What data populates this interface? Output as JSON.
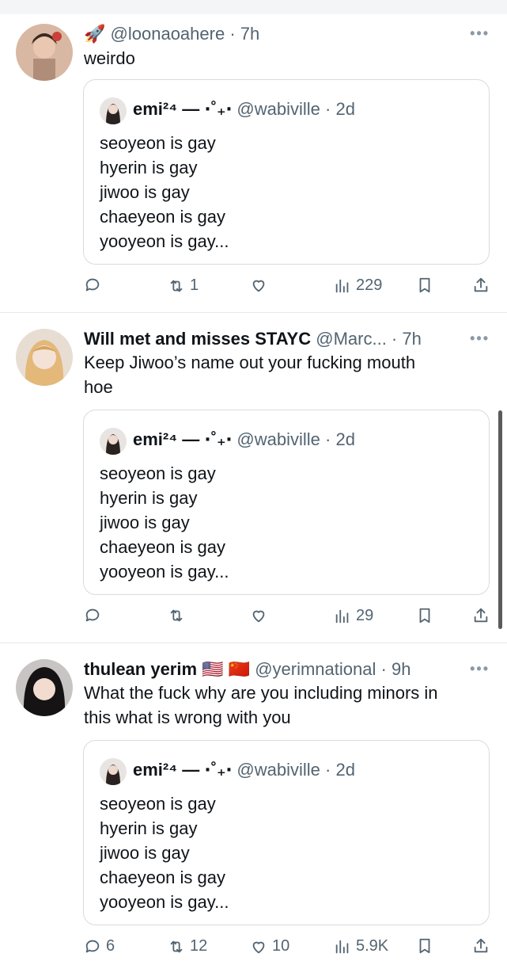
{
  "tweets": [
    {
      "display_name": "",
      "badge_emoji": "🚀",
      "handle": "@loonaoahere",
      "time": "7h",
      "text": [
        "weirdo"
      ],
      "quote": {
        "name": "emi²⁴ — ⋅˚₊‧",
        "handle": "@wabiville",
        "time": "2d",
        "lines": [
          "seoyeon is gay",
          "hyerin is gay",
          "jiwoo is gay",
          "chaeyeon is gay",
          "yooyeon is gay..."
        ]
      },
      "stats": {
        "replies": "",
        "retweets": "1",
        "likes": "",
        "views": "229"
      }
    },
    {
      "display_name": "Will met and misses STAYC",
      "badge_emoji": "",
      "handle": "@Marc...",
      "time": "7h",
      "text": [
        "Keep Jiwoo’s name out your fucking mouth",
        "hoe"
      ],
      "quote": {
        "name": "emi²⁴ — ⋅˚₊‧",
        "handle": "@wabiville",
        "time": "2d",
        "lines": [
          "seoyeon is gay",
          "hyerin is gay",
          "jiwoo is gay",
          "chaeyeon is gay",
          "yooyeon is gay..."
        ]
      },
      "stats": {
        "replies": "",
        "retweets": "",
        "likes": "",
        "views": "29"
      }
    },
    {
      "display_name": "thulean yerim",
      "badge_emoji": "🇺🇸 🇨🇳",
      "handle": "@yerimnational",
      "time": "9h",
      "text": [
        "What the fuck why are you including minors in",
        "this what is wrong with you"
      ],
      "quote": {
        "name": "emi²⁴ — ⋅˚₊‧",
        "handle": "@wabiville",
        "time": "2d",
        "lines": [
          "seoyeon is gay",
          "hyerin is gay",
          "jiwoo is gay",
          "chaeyeon is gay",
          "yooyeon is gay..."
        ]
      },
      "stats": {
        "replies": "6",
        "retweets": "12",
        "likes": "10",
        "views": "5.9K"
      }
    }
  ],
  "icons": {
    "reply": "reply-icon",
    "retweet": "retweet-icon",
    "like": "heart-icon",
    "views": "views-icon",
    "bookmark": "bookmark-icon",
    "share": "share-icon",
    "more": "more-icon"
  },
  "colors": {
    "text": "#0f1419",
    "muted": "#536471",
    "border": "#d7dce0"
  }
}
